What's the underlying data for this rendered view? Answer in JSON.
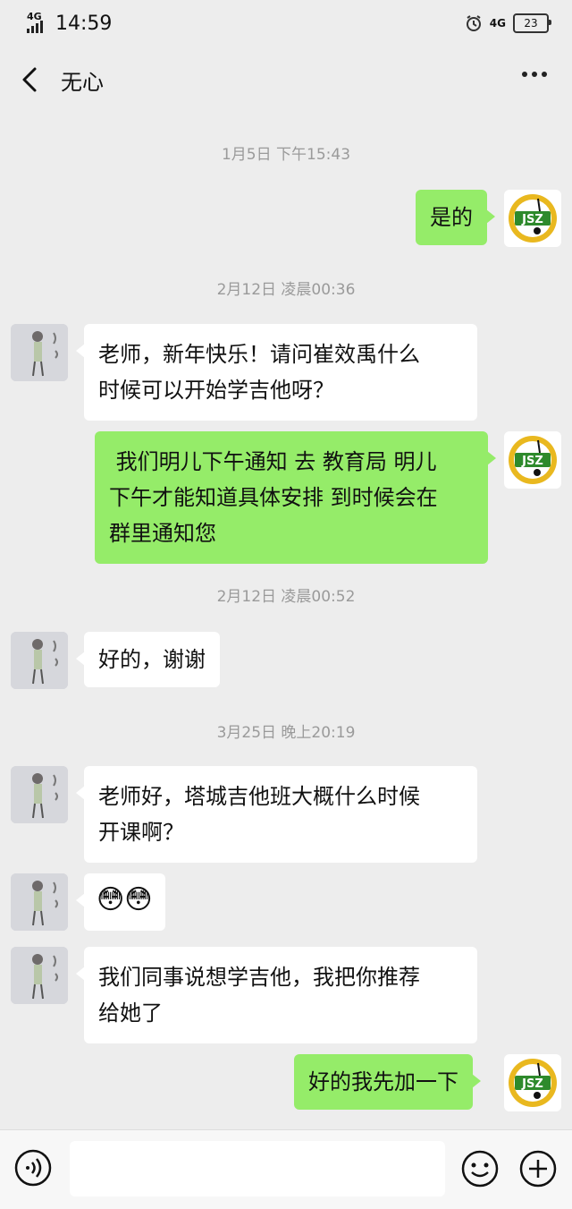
{
  "status": {
    "network": "4G",
    "time": "14:59",
    "network_right": "4G",
    "battery": "23"
  },
  "nav": {
    "title": "无心"
  },
  "messages": [
    {
      "type": "time",
      "text": "1月5日 下午15:43"
    },
    {
      "type": "msg",
      "side": "right",
      "text": "是的"
    },
    {
      "type": "time",
      "text": "2月12日 凌晨00:36"
    },
    {
      "type": "msg",
      "side": "left",
      "lines": [
        "老师，新年快乐！请问崔效禹什么",
        "时候可以开始学吉他呀？"
      ]
    },
    {
      "type": "msg",
      "side": "right",
      "lines": [
        " 我们明儿下午通知 去 教育局 明儿",
        "下午才能知道具体安排 到时候会在",
        "群里通知您"
      ]
    },
    {
      "type": "time",
      "text": "2月12日 凌晨00:52"
    },
    {
      "type": "msg",
      "side": "left",
      "text": "好的，谢谢"
    },
    {
      "type": "time",
      "text": "3月25日 晚上20:19"
    },
    {
      "type": "msg",
      "side": "left",
      "lines": [
        "老师好，塔城吉他班大概什么时候",
        "开课啊？"
      ]
    },
    {
      "type": "msg",
      "side": "left",
      "emoji": "😳😳"
    },
    {
      "type": "msg",
      "side": "left",
      "lines": [
        "我们同事说想学吉他，我把你推荐",
        "给她了"
      ]
    },
    {
      "type": "msg",
      "side": "right",
      "text": "好的我先加一下"
    }
  ],
  "logo": {
    "text": "JSZ",
    "colors": {
      "ring": "#e9b81f",
      "green": "#2e8a2c",
      "note": "#111111"
    }
  },
  "colors": {
    "green_bubble": "#95ec69",
    "background": "#ededed"
  },
  "icons": [
    "back-arrow-icon",
    "more-dots-icon",
    "voice-icon",
    "emoji-icon",
    "plus-icon",
    "alarm-icon",
    "battery-icon",
    "signal-icon"
  ]
}
